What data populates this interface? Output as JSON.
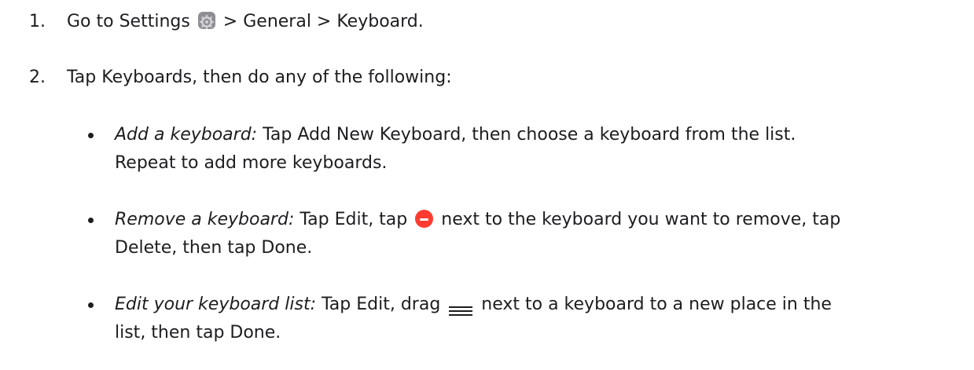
{
  "steps": [
    {
      "number": "1.",
      "before_icon": "Go to Settings",
      "icon": "settings-icon",
      "after_icon": "> General > Keyboard."
    },
    {
      "number": "2.",
      "text": "Tap Keyboards, then do any of the following:"
    }
  ],
  "bullets": [
    {
      "term": "Add a keyboard:",
      "line1": "Tap Add New Keyboard, then choose a keyboard from the list.",
      "line2": "Repeat to add more keyboards."
    },
    {
      "term": "Remove a keyboard:",
      "before_icon": "Tap Edit, tap",
      "icon": "remove-minus-icon",
      "after_icon": "next to the keyboard you want to remove, tap",
      "line2": "Delete, then tap Done."
    },
    {
      "term": "Edit your keyboard list:",
      "before_icon": "Tap Edit, drag",
      "icon": "reorder-handle-icon",
      "after_icon": "next to a keyboard to a new place in the",
      "line2": "list, then tap Done."
    }
  ],
  "colors": {
    "text": "#1d1d1f",
    "remove_icon": "#ff3b30",
    "settings_icon": "#8e8e93"
  }
}
